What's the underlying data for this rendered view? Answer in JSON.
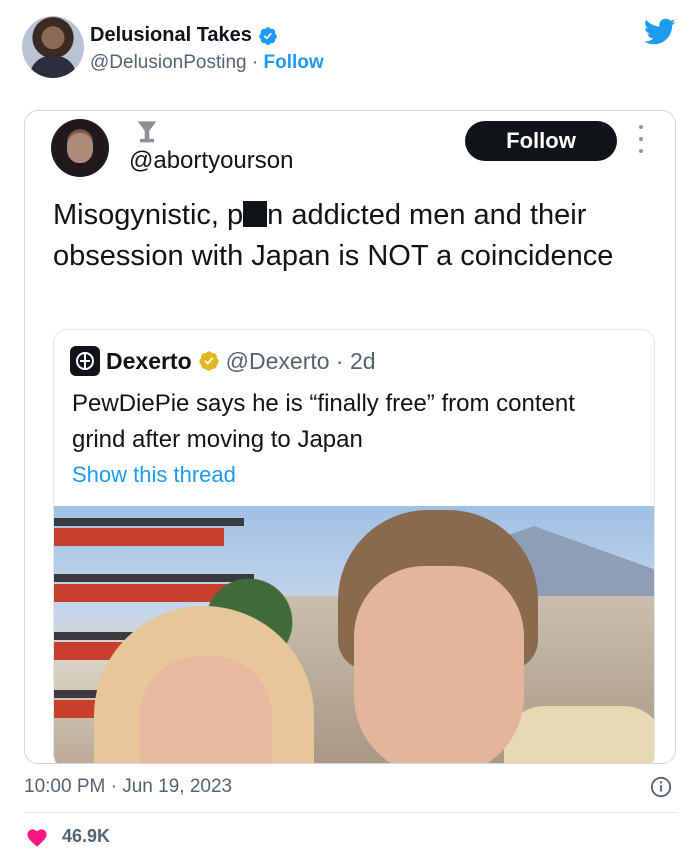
{
  "tweet": {
    "author_name": "Delusional Takes",
    "author_handle": "@DelusionPosting",
    "separator": " · ",
    "follow_label": "Follow",
    "timestamp": "10:00 PM · Jun 19, 2023",
    "likes": "46.9K",
    "colors": {
      "accent": "#1d9bf0",
      "heart": "#f91880",
      "text": "#0f1419",
      "muted": "#536471"
    }
  },
  "embedded": {
    "handle": "@abortyourson",
    "follow_label": "Follow",
    "text_part1": "Misogynistic, p",
    "text_part2": "n addicted men and their obsession with Japan is NOT a coincidence",
    "quote": {
      "name": "Dexerto",
      "handle": "@Dexerto · 2d",
      "text": "PewDiePie says he is “finally free” from content grind after moving to Japan",
      "thread_link": "Show this thread"
    }
  },
  "icons": [
    "verified-badge-icon",
    "twitter-bird-icon",
    "goblet-icon",
    "more-options-icon",
    "dexerto-logo-icon",
    "info-icon",
    "heart-icon"
  ]
}
